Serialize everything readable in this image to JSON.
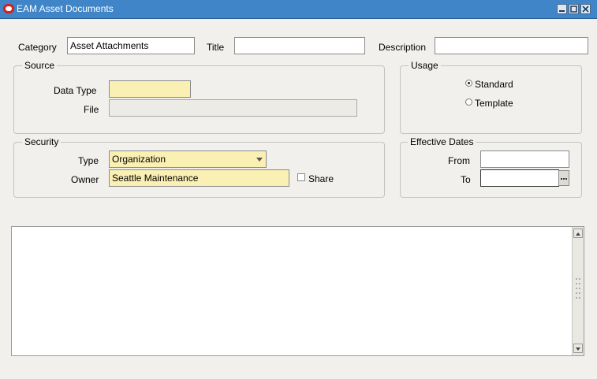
{
  "window": {
    "title": "EAM Asset Documents"
  },
  "header": {
    "category_label": "Category",
    "category_value": "Asset Attachments",
    "title_label": "Title",
    "title_value": "",
    "description_label": "Description",
    "description_value": ""
  },
  "source": {
    "legend": "Source",
    "data_type_label": "Data Type",
    "data_type_value": "",
    "file_label": "File",
    "file_value": ""
  },
  "usage": {
    "legend": "Usage",
    "options": [
      "Standard",
      "Template"
    ],
    "selected": "Standard"
  },
  "security": {
    "legend": "Security",
    "type_label": "Type",
    "type_value": "Organization",
    "owner_label": "Owner",
    "owner_value": "Seattle Maintenance",
    "share_label": "Share",
    "share_checked": false
  },
  "effective_dates": {
    "legend": "Effective Dates",
    "from_label": "From",
    "from_value": "",
    "to_label": "To",
    "to_value": "",
    "lov_button_label": "..."
  },
  "colors": {
    "titlebar": "#3f85c7",
    "required_field": "#faf0b4",
    "background": "#f1f0ec"
  }
}
